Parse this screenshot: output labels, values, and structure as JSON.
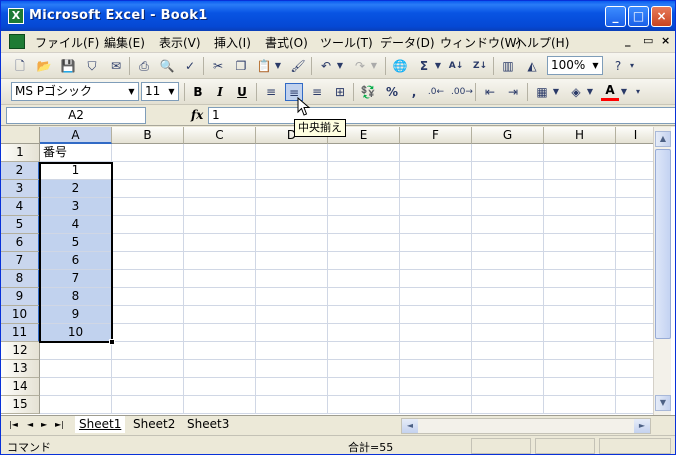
{
  "window": {
    "title": "Microsoft Excel - Book1",
    "app_icon": "excel-icon",
    "controls": {
      "minimize": "_",
      "maximize": "□",
      "close": "×"
    }
  },
  "menu": {
    "items": [
      "ファイル(F)",
      "編集(E)",
      "表示(V)",
      "挿入(I)",
      "書式(O)",
      "ツール(T)",
      "データ(D)",
      "ウィンドウ(W)",
      "ヘルプ(H)"
    ],
    "doc_controls": {
      "minimize": "_",
      "restore": "▭",
      "close": "×"
    }
  },
  "standard_toolbar": {
    "zoom": "100%",
    "icons": [
      "new-icon",
      "open-icon",
      "save-icon",
      "permission-icon",
      "email-icon",
      "print-icon",
      "print-preview-icon",
      "spelling-icon",
      "cut-icon",
      "copy-icon",
      "paste-icon",
      "format-painter-icon",
      "undo-icon",
      "redo-icon",
      "hyperlink-icon",
      "autosum-icon",
      "sort-ascending-icon",
      "sort-descending-icon",
      "chart-wizard-icon",
      "drawing-icon",
      "help-icon"
    ]
  },
  "format_toolbar": {
    "font": "MS Pゴシック",
    "size": "11",
    "bold": "B",
    "italic": "I",
    "underline": "U",
    "icons": [
      "align-left-icon",
      "align-center-icon",
      "align-right-icon",
      "merge-center-icon",
      "currency-icon",
      "percent-icon",
      "comma-icon",
      "increase-decimal-icon",
      "decrease-decimal-icon",
      "decrease-indent-icon",
      "increase-indent-icon",
      "borders-icon",
      "fill-color-icon",
      "font-color-icon"
    ],
    "percent": "%",
    "comma": ",",
    "font_color_letter": "A",
    "fill_color": "#ffff00",
    "font_color": "#ff0000"
  },
  "tooltip": {
    "text": "中央揃え"
  },
  "formula_bar": {
    "name_box": "A2",
    "fx": "fx",
    "value": "1"
  },
  "sheet": {
    "columns": [
      "A",
      "B",
      "C",
      "D",
      "E",
      "F",
      "G",
      "H",
      "I"
    ],
    "rows": [
      "1",
      "2",
      "3",
      "4",
      "5",
      "6",
      "7",
      "8",
      "9",
      "10",
      "11",
      "12",
      "13",
      "14",
      "15"
    ],
    "cells": {
      "A1": "番号",
      "A2": "1",
      "A3": "2",
      "A4": "3",
      "A5": "4",
      "A6": "5",
      "A7": "6",
      "A8": "7",
      "A9": "8",
      "A10": "9",
      "A11": "10"
    },
    "selection": "A2:A11",
    "active_cell": "A2"
  },
  "tabs": {
    "nav": [
      "|◄",
      "◄",
      "►",
      "►|"
    ],
    "sheets": [
      "Sheet1",
      "Sheet2",
      "Sheet3"
    ],
    "active": "Sheet1"
  },
  "status": {
    "mode": "コマンド",
    "sum": "合計=55"
  },
  "colors": {
    "title_bar": "#0854e3",
    "selection": "#c1d2ee",
    "selection_border": "#316ac5",
    "chrome": "#ece9d8"
  }
}
